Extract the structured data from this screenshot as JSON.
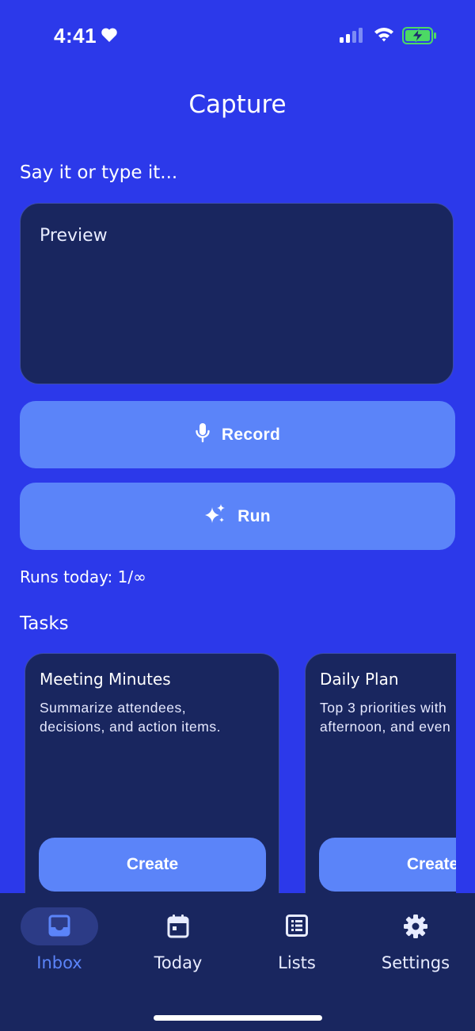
{
  "status_bar": {
    "time": "4:41",
    "icons": [
      "heart-icon",
      "cellular-signal-icon",
      "wifi-icon",
      "battery-charging-icon"
    ],
    "battery_color": "#4cd964"
  },
  "header": {
    "title": "Capture"
  },
  "capture": {
    "hint": "Say it or type it...",
    "preview_placeholder": "Preview",
    "record_label": "Record",
    "run_label": "Run",
    "runs_today": "Runs today: 1/∞"
  },
  "tasks": {
    "heading": "Tasks",
    "cards": [
      {
        "title": "Meeting Minutes",
        "description_lines": [
          "Summarize attendees,",
          "decisions, and action items."
        ],
        "button": "Create"
      },
      {
        "title": "Daily Plan",
        "description_lines": [
          "Top 3 priorities with",
          "afternoon, and even"
        ],
        "button": "Create"
      }
    ]
  },
  "tab_bar": {
    "items": [
      {
        "label": "Inbox",
        "icon": "inbox-tray-icon",
        "active": true
      },
      {
        "label": "Today",
        "icon": "calendar-icon",
        "active": false
      },
      {
        "label": "Lists",
        "icon": "list-document-icon",
        "active": false
      },
      {
        "label": "Settings",
        "icon": "gear-icon",
        "active": false
      }
    ]
  },
  "colors": {
    "background": "#2c39ea",
    "card": "#19265f",
    "button": "#5b84f9",
    "active_tab": "#5b84f9"
  }
}
